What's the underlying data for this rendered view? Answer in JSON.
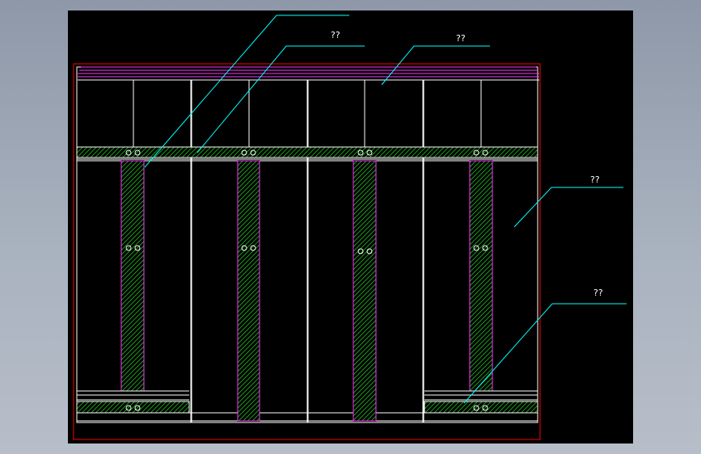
{
  "colors": {
    "background": "#000000",
    "frame": "#ff0000",
    "lines": "#ffffff",
    "hatch": "#1e9c1e",
    "cap": "#ff33ff",
    "leaders": "#00ffff"
  },
  "labels": {
    "l1": "",
    "l2": "??",
    "l3": "??",
    "l4": "??",
    "l5": "??"
  }
}
